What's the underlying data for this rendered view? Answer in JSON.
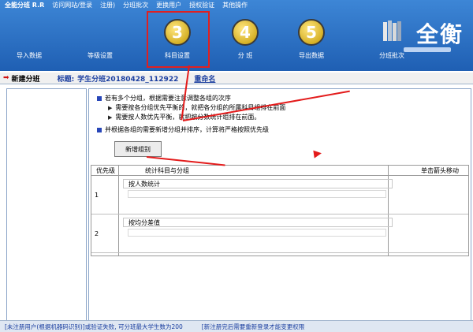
{
  "app": {
    "title": "全能分班 R.R"
  },
  "menubar": [
    "访问网站/登录",
    "注册)",
    "分班批次",
    "更换用户",
    "授权验证",
    "其他操作"
  ],
  "toolbar": [
    {
      "label": "导入数据",
      "icon": "import-icon"
    },
    {
      "label": "等级设置",
      "icon": "grade-settings-icon"
    },
    {
      "label": "科目设置",
      "icon": "step-3-icon",
      "num": "3"
    },
    {
      "label": "分  班",
      "icon": "step-4-icon",
      "num": "4"
    },
    {
      "label": "导出数据",
      "icon": "step-5-icon",
      "num": "5"
    },
    {
      "label": "分班批次",
      "icon": "books-icon"
    }
  ],
  "logo": "全衡",
  "subbar": {
    "new_label": "新建分班",
    "title_label": "标题:",
    "title_value": "学生分班20180428_112922",
    "rename": "重命名"
  },
  "instructions": {
    "line1": "若有多个分组，根据需要注意调整各组的次序",
    "line2": "需要按各分组优先平衡的，就把各分组的所属科目组排在前面",
    "line3": "需要按人数优先平衡，就把按分数统计组排在前面。",
    "line4": "并根据各组的需要新增分组并排序，计算将严格按照优先级"
  },
  "add_group_button": "新增组别",
  "table": {
    "headers": {
      "priority": "优先级",
      "subject": "统计科目与分组",
      "move": "单击箭头移动"
    },
    "rows": [
      {
        "priority": "1",
        "group": "按人数统计"
      },
      {
        "priority": "2",
        "group": "按均分差值"
      }
    ]
  },
  "status": {
    "left": "[未注册用户(根据机器码识别)]或验证失败, 可分班最大学生数为200",
    "right": "[新注册完后需要重新登录才能变更权限"
  },
  "colors": {
    "toolbar_bg": "#2f74c9",
    "highlight": "#e02020",
    "arrow": "#e31b1b"
  }
}
